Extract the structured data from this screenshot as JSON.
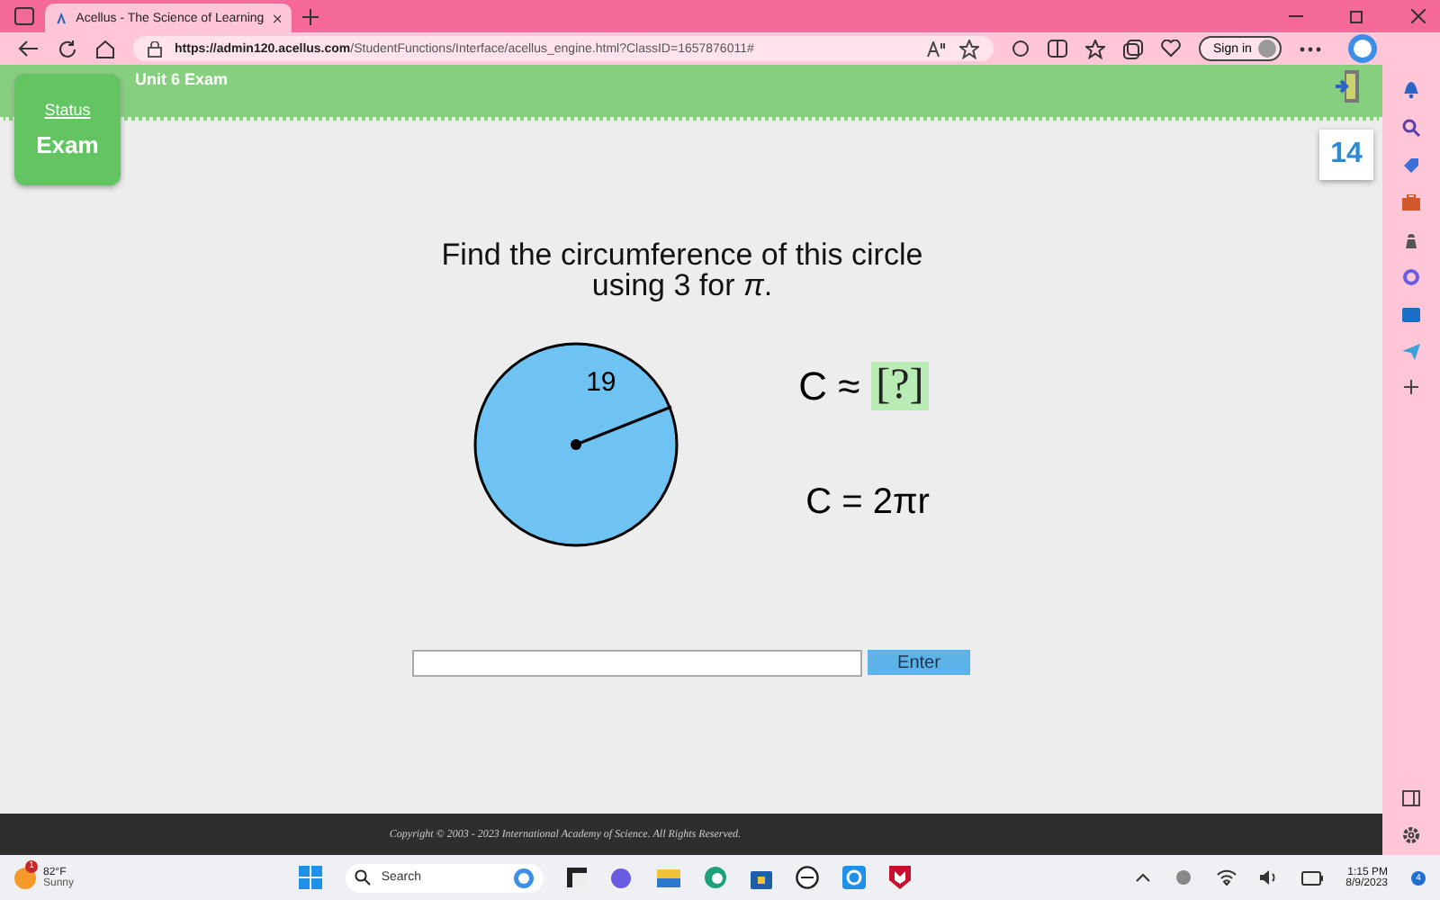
{
  "browser": {
    "tab_title": "Acellus - The Science of Learning",
    "url_host": "https://admin120.acellus.com",
    "url_path": "/StudentFunctions/Interface/acellus_engine.html?ClassID=1657876011#",
    "sign_in": "Sign in"
  },
  "header": {
    "title": "Unit 6 Exam",
    "status_link": "Status",
    "mode": "Exam",
    "question_number": "14"
  },
  "question": {
    "lines": [
      "Find the circumference of this circle",
      "using 3 for *π*."
    ],
    "radius_label": "19",
    "equation": "C ≈",
    "answer_slot": "[?]",
    "formula": "C = 2πr"
  },
  "answer": {
    "button": "Enter"
  },
  "footer": {
    "copyright": "Copyright © 2003 - 2023 International Academy of Science.  All Rights Reserved."
  },
  "taskbar": {
    "weather_badge": "1",
    "temperature": "82°F",
    "condition": "Sunny",
    "search_placeholder": "Search",
    "time": "1:15 PM",
    "date": "8/9/2023",
    "notifications": "4"
  }
}
